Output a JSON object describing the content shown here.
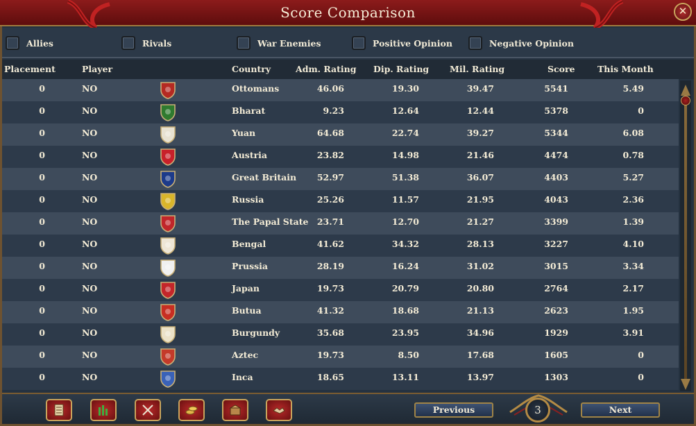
{
  "window": {
    "title": "Score Comparison",
    "close_glyph": "✕"
  },
  "filters": [
    {
      "label": "Allies",
      "checked": false
    },
    {
      "label": "Rivals",
      "checked": false
    },
    {
      "label": "War Enemies",
      "checked": false
    },
    {
      "label": "Positive Opinion",
      "checked": false
    },
    {
      "label": "Negative Opinion",
      "checked": false
    }
  ],
  "columns": {
    "placement": "Placement",
    "player": "Player",
    "country": "Country",
    "adm": "Adm. Rating",
    "dip": "Dip. Rating",
    "mil": "Mil. Rating",
    "score": "Score",
    "month": "This Month"
  },
  "rows": [
    {
      "placement": "0",
      "player": "NO",
      "country": "Ottomans",
      "adm": "46.06",
      "dip": "19.30",
      "mil": "39.47",
      "score": "5541",
      "month": "5.49",
      "flag": "ottomans-flag-icon",
      "color": "#b52a22"
    },
    {
      "placement": "0",
      "player": "NO",
      "country": "Bharat",
      "adm": "9.23",
      "dip": "12.64",
      "mil": "12.44",
      "score": "5378",
      "month": "0",
      "flag": "bharat-flag-icon",
      "color": "#2f7a2f"
    },
    {
      "placement": "0",
      "player": "NO",
      "country": "Yuan",
      "adm": "64.68",
      "dip": "22.74",
      "mil": "39.27",
      "score": "5344",
      "month": "6.08",
      "flag": "yuan-flag-icon",
      "color": "#e8e2d2"
    },
    {
      "placement": "0",
      "player": "NO",
      "country": "Austria",
      "adm": "23.82",
      "dip": "14.98",
      "mil": "21.46",
      "score": "4474",
      "month": "0.78",
      "flag": "austria-flag-icon",
      "color": "#c8202a"
    },
    {
      "placement": "0",
      "player": "NO",
      "country": "Great Britain",
      "adm": "52.97",
      "dip": "51.38",
      "mil": "36.07",
      "score": "4403",
      "month": "5.27",
      "flag": "great-britain-flag-icon",
      "color": "#1d3b8a"
    },
    {
      "placement": "0",
      "player": "NO",
      "country": "Russia",
      "adm": "25.26",
      "dip": "11.57",
      "mil": "21.95",
      "score": "4043",
      "month": "2.36",
      "flag": "russia-flag-icon",
      "color": "#d9b52a"
    },
    {
      "placement": "0",
      "player": "NO",
      "country": "The Papal State",
      "adm": "23.71",
      "dip": "12.70",
      "mil": "21.27",
      "score": "3399",
      "month": "1.39",
      "flag": "papal-state-flag-icon",
      "color": "#c0262a"
    },
    {
      "placement": "0",
      "player": "NO",
      "country": "Bengal",
      "adm": "41.62",
      "dip": "34.32",
      "mil": "28.13",
      "score": "3227",
      "month": "4.10",
      "flag": "bengal-flag-icon",
      "color": "#eee6d6"
    },
    {
      "placement": "0",
      "player": "NO",
      "country": "Prussia",
      "adm": "28.19",
      "dip": "16.24",
      "mil": "31.02",
      "score": "3015",
      "month": "3.34",
      "flag": "prussia-flag-icon",
      "color": "#f0f0f0"
    },
    {
      "placement": "0",
      "player": "NO",
      "country": "Japan",
      "adm": "19.73",
      "dip": "20.79",
      "mil": "20.80",
      "score": "2764",
      "month": "2.17",
      "flag": "japan-flag-icon",
      "color": "#c4262a"
    },
    {
      "placement": "0",
      "player": "NO",
      "country": "Butua",
      "adm": "41.32",
      "dip": "18.68",
      "mil": "21.13",
      "score": "2623",
      "month": "1.95",
      "flag": "butua-flag-icon",
      "color": "#c72e22"
    },
    {
      "placement": "0",
      "player": "NO",
      "country": "Burgundy",
      "adm": "35.68",
      "dip": "23.95",
      "mil": "34.96",
      "score": "1929",
      "month": "3.91",
      "flag": "burgundy-flag-icon",
      "color": "#ece2c8"
    },
    {
      "placement": "0",
      "player": "NO",
      "country": "Aztec",
      "adm": "19.73",
      "dip": "8.50",
      "mil": "17.68",
      "score": "1605",
      "month": "0",
      "flag": "aztec-flag-icon",
      "color": "#c43a2a"
    },
    {
      "placement": "0",
      "player": "NO",
      "country": "Inca",
      "adm": "18.65",
      "dip": "13.11",
      "mil": "13.97",
      "score": "1303",
      "month": "0",
      "flag": "inca-flag-icon",
      "color": "#3a62b8"
    }
  ],
  "bottom": {
    "category_buttons": [
      "ledger-icon",
      "bar-chart-icon",
      "crossed-swords-icon",
      "coins-icon",
      "trade-goods-icon",
      "handshake-icon"
    ],
    "previous_label": "Previous",
    "next_label": "Next",
    "page": "3"
  }
}
